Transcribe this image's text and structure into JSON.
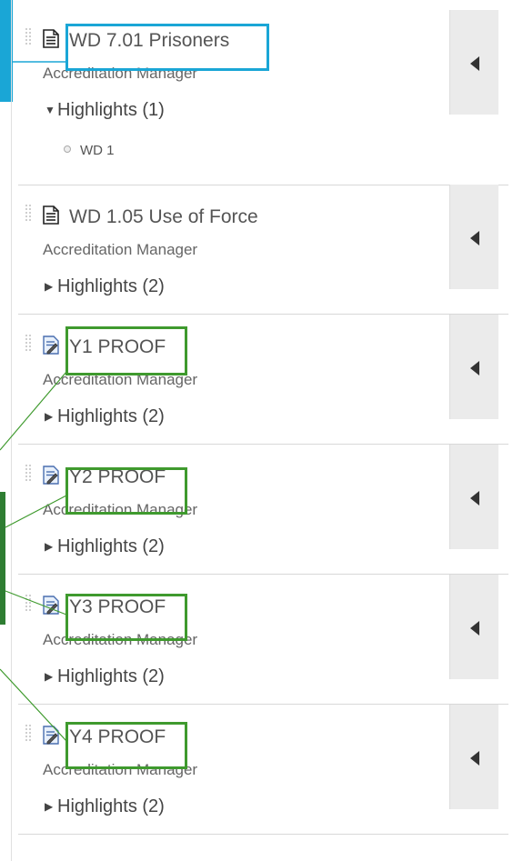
{
  "items": [
    {
      "title": "WD 7.01 Prisoners",
      "subtitle": "Accreditation Manager",
      "highlights_label": "Highlights (1)",
      "expanded": true,
      "icon": "document-icon",
      "highlights": [
        "WD 1"
      ]
    },
    {
      "title": "WD 1.05 Use of Force",
      "subtitle": "Accreditation Manager",
      "highlights_label": "Highlights (2)",
      "expanded": false,
      "icon": "document-icon"
    },
    {
      "title": "Y1 PROOF",
      "subtitle": "Accreditation Manager",
      "highlights_label": "Highlights (2)",
      "expanded": false,
      "icon": "edit-document-icon"
    },
    {
      "title": "Y2 PROOF",
      "subtitle": "Accreditation Manager",
      "highlights_label": "Highlights (2)",
      "expanded": false,
      "icon": "edit-document-icon"
    },
    {
      "title": "Y3 PROOF",
      "subtitle": "Accreditation Manager",
      "highlights_label": "Highlights (2)",
      "expanded": false,
      "icon": "edit-document-icon"
    },
    {
      "title": "Y4 PROOF",
      "subtitle": "Accreditation Manager",
      "highlights_label": "Highlights (2)",
      "expanded": false,
      "icon": "edit-document-icon"
    }
  ],
  "colors": {
    "callout_blue": "#1aa6d6",
    "callout_green": "#3f9a2e",
    "callout_green_dark": "#2e7d32"
  }
}
